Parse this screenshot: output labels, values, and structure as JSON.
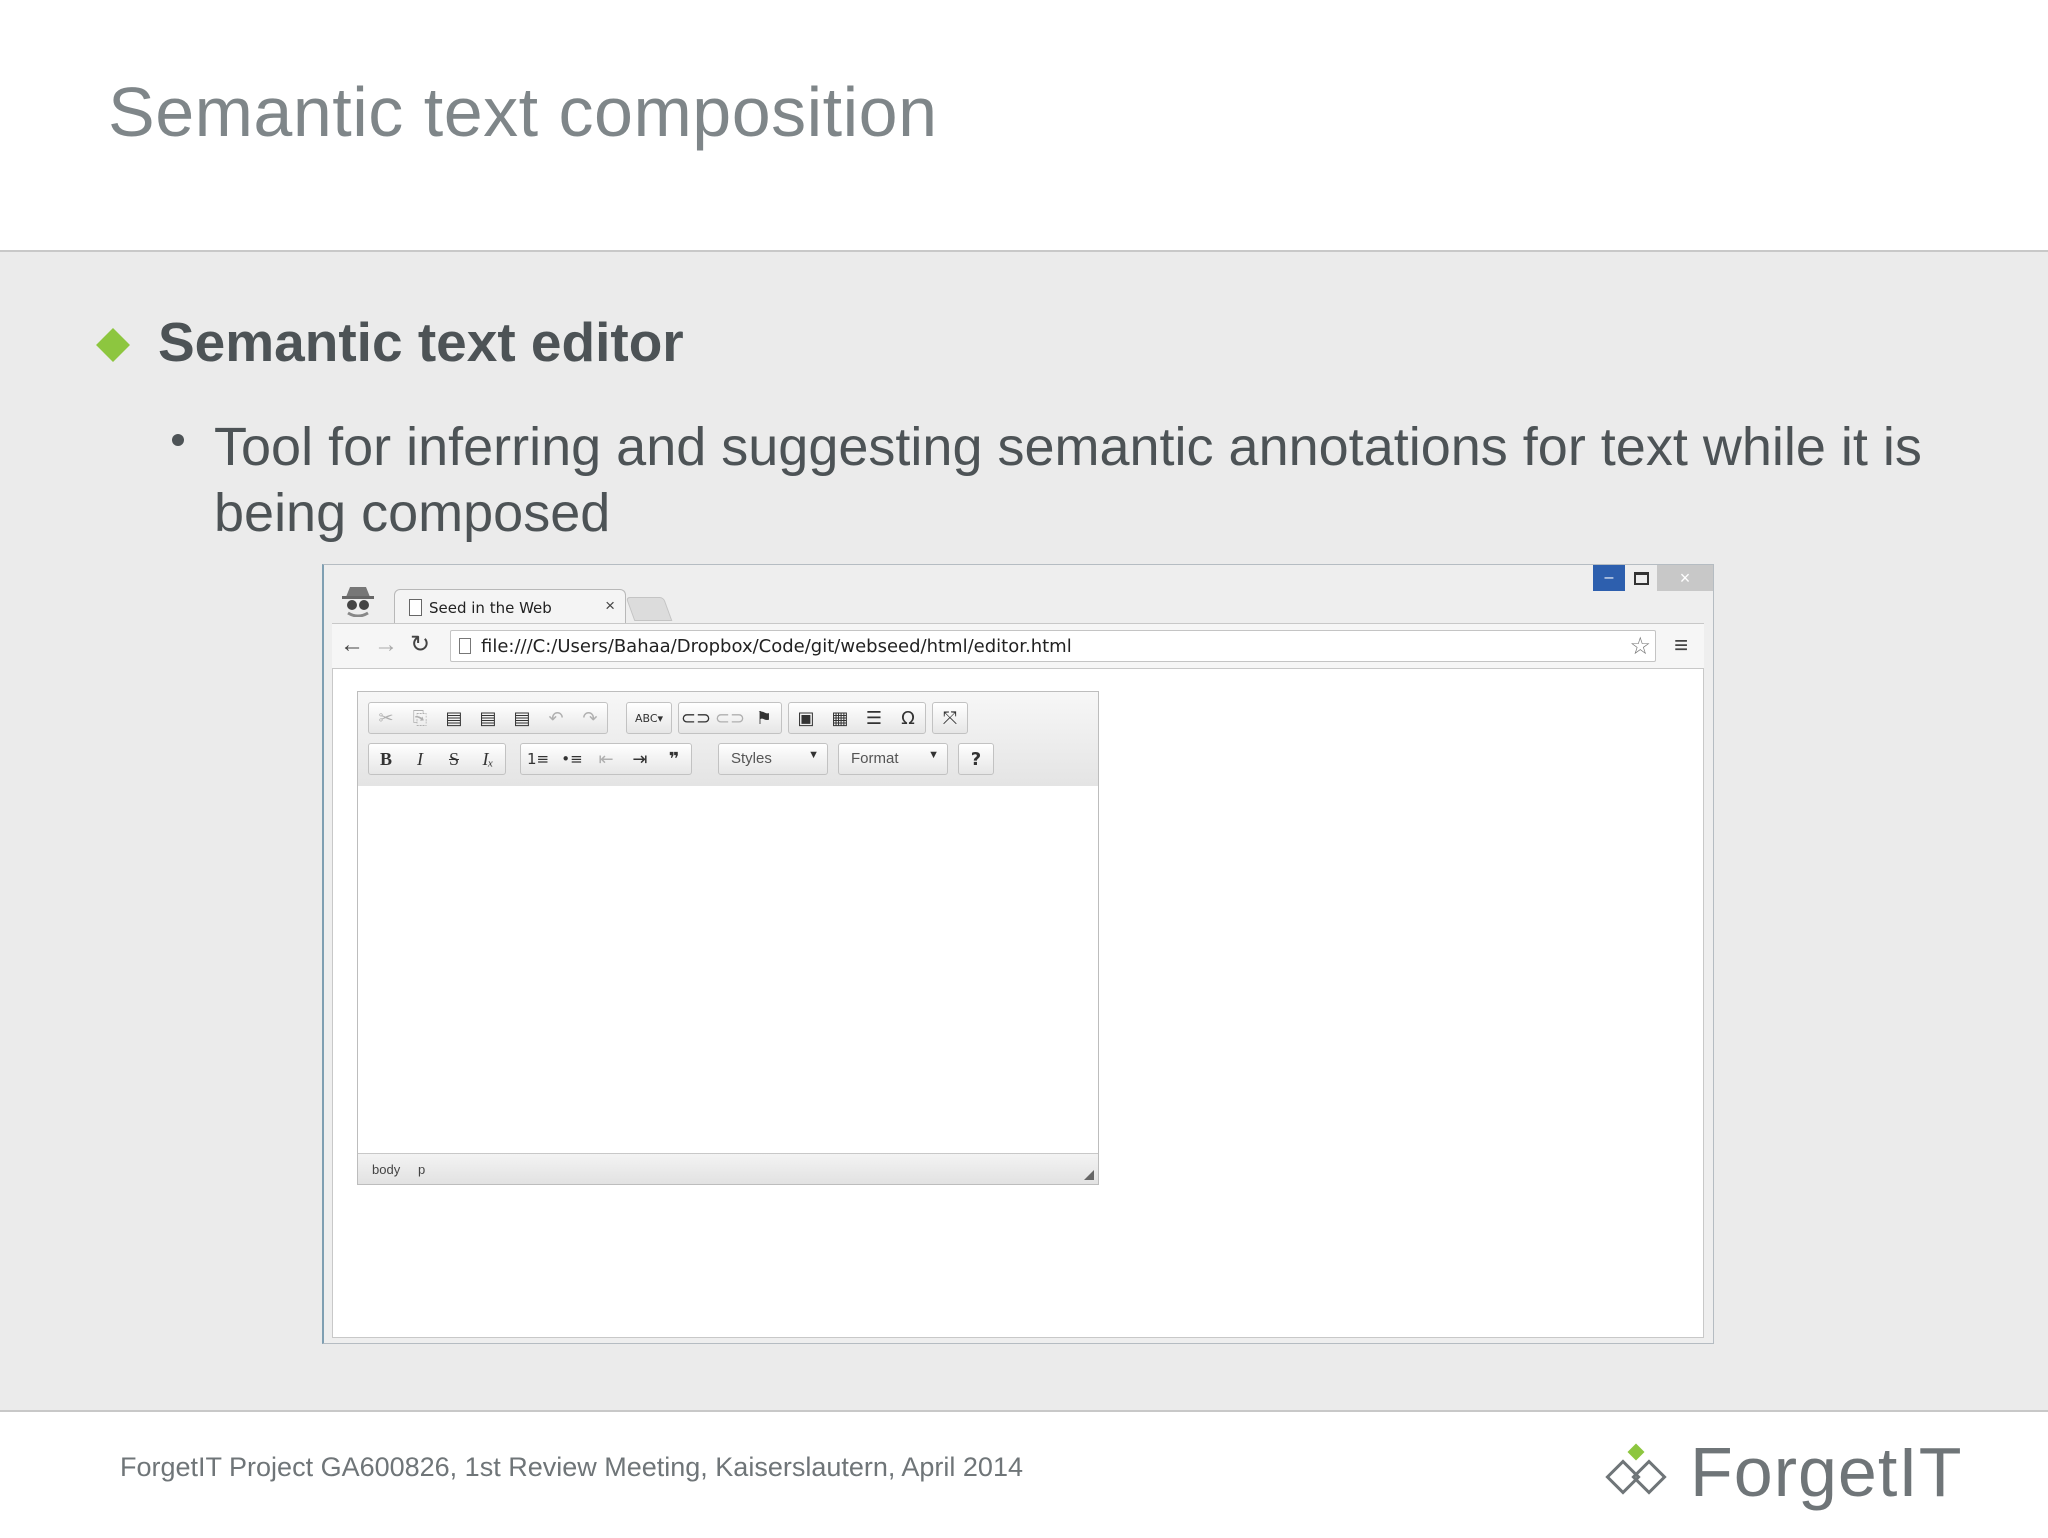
{
  "slide": {
    "title": "Semantic text composition",
    "heading": "Semantic text editor",
    "bullet": "Tool for inferring and suggesting semantic annotations for text while it is being composed"
  },
  "browser": {
    "tab_title": "Seed in the Web",
    "tab_close": "×",
    "url": "file:///C:/Users/Bahaa/Dropbox/Code/git/webseed/html/editor.html",
    "window_controls": {
      "minimize": "–",
      "close": "×"
    }
  },
  "editor": {
    "toolbar_row1": [
      {
        "name": "cut-icon",
        "glyph": "✂",
        "enabled": false
      },
      {
        "name": "copy-icon",
        "glyph": "⎘",
        "enabled": false
      },
      {
        "name": "paste-icon",
        "glyph": "📋",
        "enabled": true
      },
      {
        "name": "paste-text-icon",
        "glyph": "📋",
        "enabled": true
      },
      {
        "name": "paste-word-icon",
        "glyph": "📋",
        "enabled": true
      },
      {
        "name": "undo-icon",
        "glyph": "↶",
        "enabled": false
      },
      {
        "name": "redo-icon",
        "glyph": "↷",
        "enabled": false
      },
      {
        "name": "spellcheck-icon",
        "glyph": "ABC▾",
        "enabled": true
      },
      {
        "name": "link-icon",
        "glyph": "🔗",
        "enabled": true
      },
      {
        "name": "unlink-icon",
        "glyph": "⛓",
        "enabled": false
      },
      {
        "name": "anchor-icon",
        "glyph": "⚑",
        "enabled": true
      },
      {
        "name": "image-icon",
        "glyph": "🖼",
        "enabled": true
      },
      {
        "name": "table-icon",
        "glyph": "▦",
        "enabled": true
      },
      {
        "name": "horizontal-rule-icon",
        "glyph": "☰",
        "enabled": true
      },
      {
        "name": "special-char-icon",
        "glyph": "Ω",
        "enabled": true
      },
      {
        "name": "maximize-icon",
        "glyph": "⤧",
        "enabled": true
      }
    ],
    "toolbar_row2": [
      {
        "name": "bold-icon",
        "glyph": "B",
        "enabled": true
      },
      {
        "name": "italic-icon",
        "glyph": "I",
        "enabled": true
      },
      {
        "name": "strike-icon",
        "glyph": "S",
        "enabled": true
      },
      {
        "name": "remove-format-icon",
        "glyph": "Iₓ",
        "enabled": true
      },
      {
        "name": "numbered-list-icon",
        "glyph": "⒈",
        "enabled": true
      },
      {
        "name": "bulleted-list-icon",
        "glyph": "⁝≡",
        "enabled": true
      },
      {
        "name": "outdent-icon",
        "glyph": "⇤",
        "enabled": false
      },
      {
        "name": "indent-icon",
        "glyph": "⇥",
        "enabled": true
      },
      {
        "name": "blockquote-icon",
        "glyph": "❞",
        "enabled": true
      }
    ],
    "styles_label": "Styles",
    "format_label": "Format",
    "help_label": "?",
    "elements_path": [
      "body",
      "p"
    ]
  },
  "footer": {
    "text": "ForgetIT Project GA600826, 1st Review Meeting, Kaiserslautern, April 2014",
    "logo_text": "ForgetIT"
  },
  "colors": {
    "accent_green": "#8dc63f",
    "title_gray": "#7f8689",
    "text_gray": "#4d5356",
    "minimize_blue": "#2d5fae"
  }
}
